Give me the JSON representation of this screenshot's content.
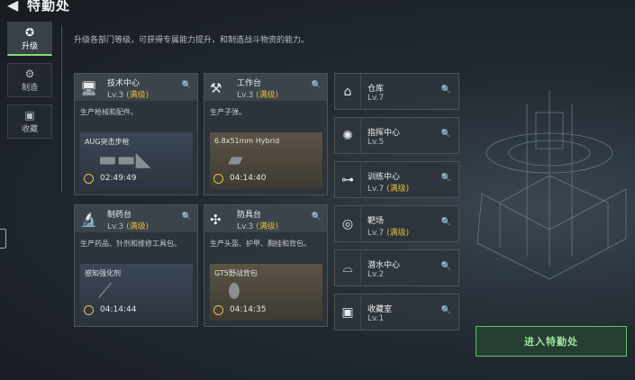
{
  "header": {
    "title": "特勤处"
  },
  "sidebar": {
    "tabs": [
      {
        "label": "升级"
      },
      {
        "label": "制造"
      },
      {
        "label": "收藏"
      }
    ]
  },
  "description": "升级各部门等级，可获得专属能力提升，和制造战斗物资的能力。",
  "stations": [
    {
      "name": "技术中心",
      "level": "Lv.3",
      "max": "(满级)",
      "desc": "生产枪械和配件。",
      "item": "AUG突击步枪",
      "time": "02:49:49",
      "icon": "monitor-icon"
    },
    {
      "name": "工作台",
      "level": "Lv.3",
      "max": "(满级)",
      "desc": "生产子弹。",
      "item": "6.8x51mm Hybrid",
      "time": "04:14:40",
      "icon": "tools-icon"
    },
    {
      "name": "制药台",
      "level": "Lv.3",
      "max": "(满级)",
      "desc": "生产药品、针剂和维修工具包。",
      "item": "感知强化剂",
      "time": "04:14:44",
      "icon": "microscope-icon"
    },
    {
      "name": "防具台",
      "level": "Lv.3",
      "max": "(满级)",
      "desc": "生产头盔、护甲、胸挂和背包。",
      "item": "GT5野战背包",
      "time": "04:14:35",
      "icon": "armor-icon"
    }
  ],
  "facilities": [
    {
      "name": "仓库",
      "level": "Lv.7",
      "max": "",
      "icon": "warehouse-icon"
    },
    {
      "name": "指挥中心",
      "level": "Lv.5",
      "max": "",
      "icon": "command-icon"
    },
    {
      "name": "训练中心",
      "level": "Lv.7",
      "max": "(满级)",
      "icon": "dumbbell-icon"
    },
    {
      "name": "靶场",
      "level": "Lv.7",
      "max": "(满级)",
      "icon": "target-icon"
    },
    {
      "name": "潜水中心",
      "level": "Lv.2",
      "max": "",
      "icon": "dive-icon"
    },
    {
      "name": "收藏室",
      "level": "Lv.1",
      "max": "",
      "icon": "collection-icon"
    }
  ],
  "enter_button": "进入特勤处",
  "colors": {
    "accent_green": "#7fdc73",
    "max_gold": "#e2b83c"
  }
}
